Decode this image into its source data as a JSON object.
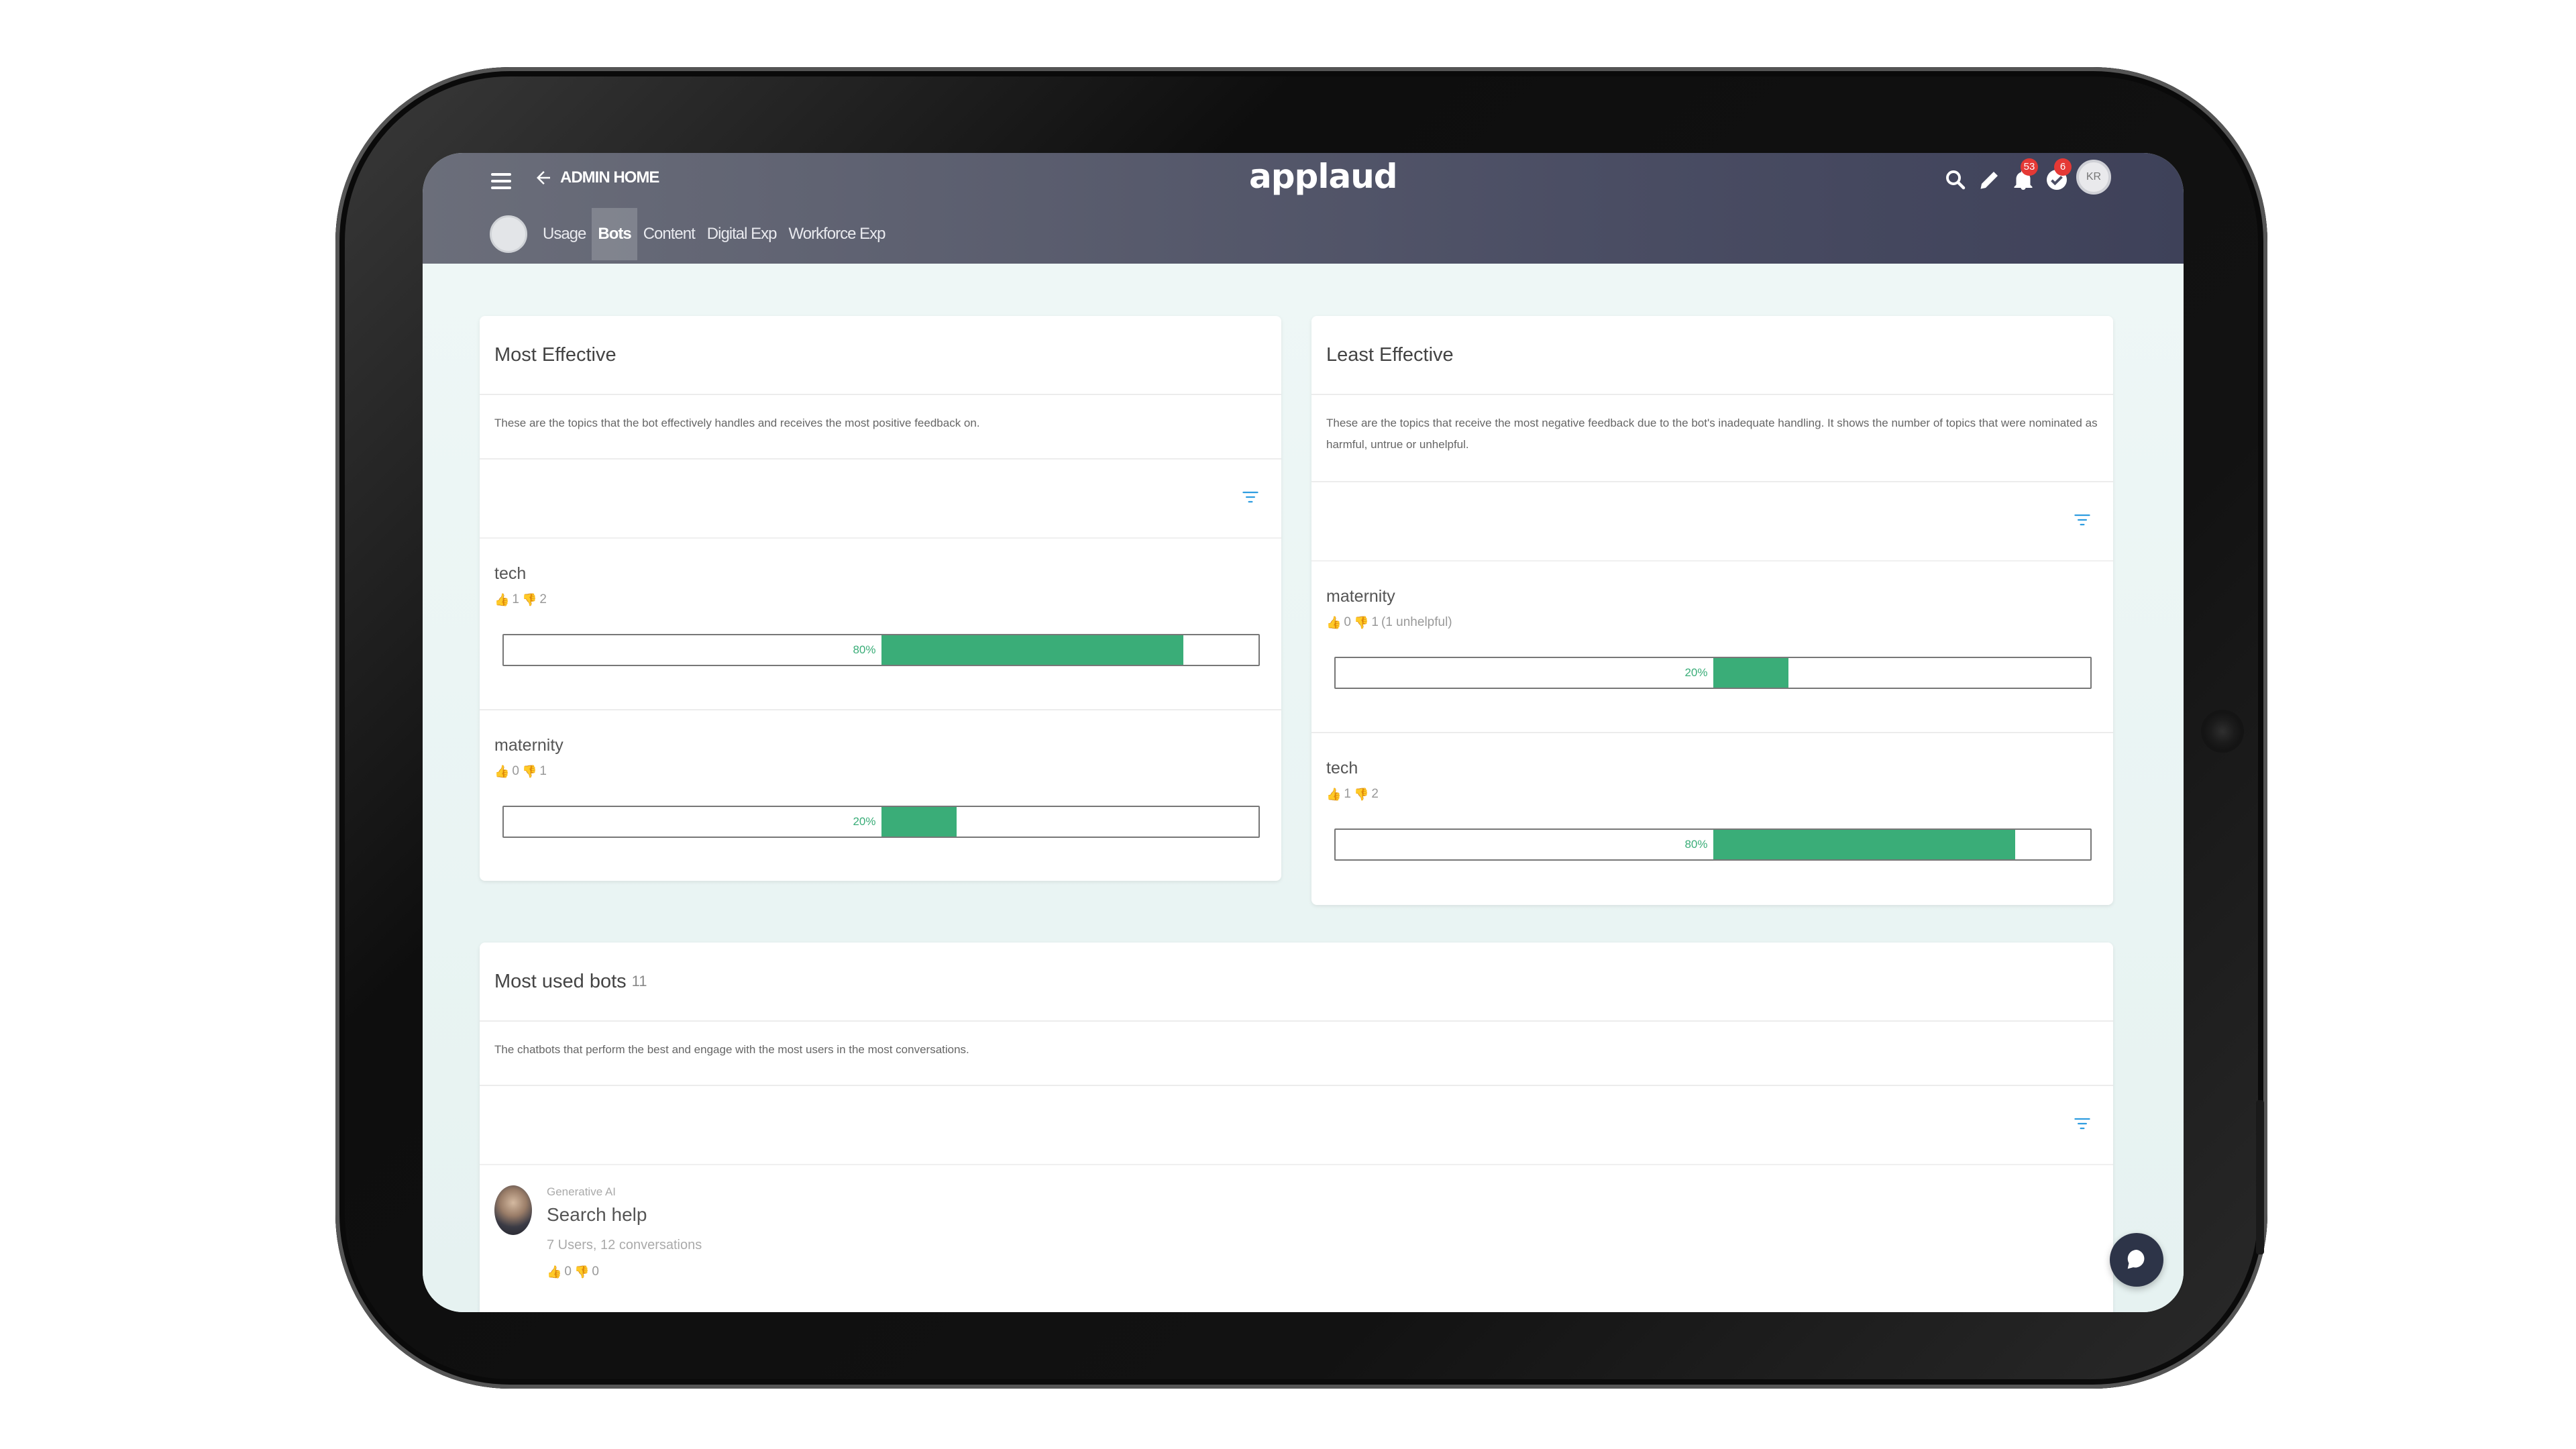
{
  "header": {
    "back_label": "ADMIN HOME",
    "brand": "applaud",
    "notifications_count": "53",
    "tasks_count": "6",
    "user_initials": "KR"
  },
  "tabs": [
    {
      "label": "Usage",
      "active": false
    },
    {
      "label": "Bots",
      "active": true
    },
    {
      "label": "Content",
      "active": false
    },
    {
      "label": "Digital Exp",
      "active": false
    },
    {
      "label": "Workforce Exp",
      "active": false
    }
  ],
  "most_effective": {
    "title": "Most Effective",
    "description": "These are the topics that the bot effectively handles and receives the most positive feedback on.",
    "topics": [
      {
        "name": "tech",
        "up": "1",
        "down": "2",
        "extra": "",
        "percent_label": "80%",
        "percent": 0.8
      },
      {
        "name": "maternity",
        "up": "0",
        "down": "1",
        "extra": "",
        "percent_label": "20%",
        "percent": 0.2
      }
    ]
  },
  "least_effective": {
    "title": "Least Effective",
    "description": "These are the topics that receive the most negative feedback due to the bot's inadequate handling. It shows the number of topics that were nominated as harmful, untrue or unhelpful.",
    "topics": [
      {
        "name": "maternity",
        "up": "0",
        "down": "1",
        "extra": "(1 unhelpful)",
        "percent_label": "20%",
        "percent": 0.2
      },
      {
        "name": "tech",
        "up": "1",
        "down": "2",
        "extra": "",
        "percent_label": "80%",
        "percent": 0.8
      }
    ]
  },
  "most_used": {
    "title": "Most used bots",
    "count": "11",
    "description": "The chatbots that perform the best and engage with the most users in the most conversations.",
    "bots": [
      {
        "category": "Generative AI",
        "name": "Search help",
        "meta": "7 Users, 12 conversations",
        "up": "0",
        "down": "0"
      }
    ]
  },
  "colors": {
    "accent_green": "#3aad78",
    "header_start": "#6b6e7a",
    "header_end": "#3e4159",
    "badge_red": "#e53935",
    "filter_blue": "#2f9de0"
  },
  "icons": {
    "menu": "hamburger-icon",
    "back": "arrow-left-icon",
    "search": "search-icon",
    "edit": "pencil-icon",
    "notifications": "bell-icon",
    "tasks": "check-circle-icon",
    "filter": "filter-icon",
    "chat": "chat-bubble-icon"
  }
}
